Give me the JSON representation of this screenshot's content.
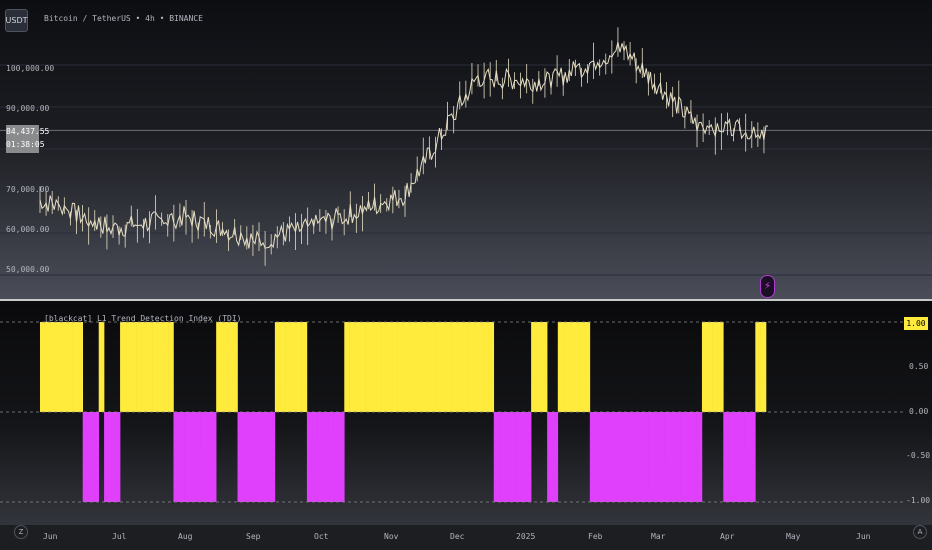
{
  "header": {
    "symbol_badge": "USDT",
    "symbol_title": "Bitcoin / TetherUS • 4h • BINANCE"
  },
  "indicator": {
    "title": "[blackcat] L1 Trend Detection Index (TDI)"
  },
  "price_axis": {
    "labels": [
      "100,000.00",
      "90,000.00",
      "70,000.00",
      "60,000.00",
      "50,000.00"
    ],
    "current_price": "84,437.55",
    "countdown": "01:38:05"
  },
  "indicator_axis": {
    "current": "1.00",
    "labels": [
      "0.50",
      "0.00",
      "-0.50",
      "-1.00"
    ]
  },
  "time_axis": {
    "labels": [
      "Jun",
      "Jul",
      "Aug",
      "Sep",
      "Oct",
      "Nov",
      "Dec",
      "2025",
      "Feb",
      "Mar",
      "Apr",
      "May",
      "Jun"
    ]
  },
  "buttons": {
    "goto_start": "Z",
    "auto_scale": "A"
  },
  "icons": {
    "flash": "flash-icon",
    "goto_start": "circle-z-icon",
    "auto_scale": "circle-a-icon"
  },
  "colors": {
    "candles": "#e6dfc3",
    "tdi_up": "#ffeb3b",
    "tdi_down": "#e040fb",
    "current_price_bg": "#8a8b8d"
  },
  "chart_data": [
    {
      "type": "line",
      "title": "Bitcoin / TetherUS • 4h • BINANCE",
      "ylim": [
        45000,
        115000
      ],
      "ticks": [
        50000,
        60000,
        70000,
        90000,
        100000
      ],
      "x": [
        "Jun",
        "Jul",
        "Aug",
        "Sep",
        "Oct",
        "Nov",
        "Dec",
        "2025",
        "Feb",
        "Mar",
        "Apr"
      ],
      "series": [
        {
          "values": [
            68000,
            61000,
            64000,
            58000,
            63000,
            69000,
            97000,
            96000,
            104000,
            86000,
            84437
          ]
        }
      ]
    },
    {
      "type": "bar",
      "title": "[blackcat] L1 Trend Detection Index (TDI)",
      "ylim": [
        -1.1,
        1.1
      ],
      "ticks": [
        1.0,
        0.5,
        0.0,
        -0.5,
        -1.0
      ],
      "values": [
        1,
        1,
        1,
        1,
        1,
        1,
        1,
        1,
        -1,
        -1,
        -1,
        1,
        -1,
        -1,
        -1,
        1,
        1,
        1,
        1,
        1,
        1,
        1,
        1,
        1,
        1,
        -1,
        -1,
        -1,
        -1,
        -1,
        -1,
        -1,
        -1,
        1,
        1,
        1,
        1,
        -1,
        -1,
        -1,
        -1,
        -1,
        -1,
        -1,
        1,
        1,
        1,
        1,
        1,
        1,
        -1,
        -1,
        -1,
        -1,
        -1,
        -1,
        -1,
        1,
        1,
        1,
        1,
        1,
        1,
        1,
        1,
        1,
        1,
        1,
        1,
        1,
        1,
        1,
        1,
        1,
        1,
        1,
        1,
        1,
        1,
        1,
        1,
        1,
        1,
        1,
        1,
        -1,
        -1,
        -1,
        -1,
        -1,
        -1,
        -1,
        1,
        1,
        1,
        -1,
        -1,
        1,
        1,
        1,
        1,
        1,
        1,
        -1,
        -1,
        -1,
        -1,
        -1,
        -1,
        -1,
        -1,
        -1,
        -1,
        -1,
        -1,
        -1,
        -1,
        -1,
        -1,
        -1,
        -1,
        -1,
        -1,
        -1,
        1,
        1,
        1,
        1,
        -1,
        -1,
        -1,
        -1,
        -1,
        -1,
        1,
        1
      ]
    }
  ]
}
